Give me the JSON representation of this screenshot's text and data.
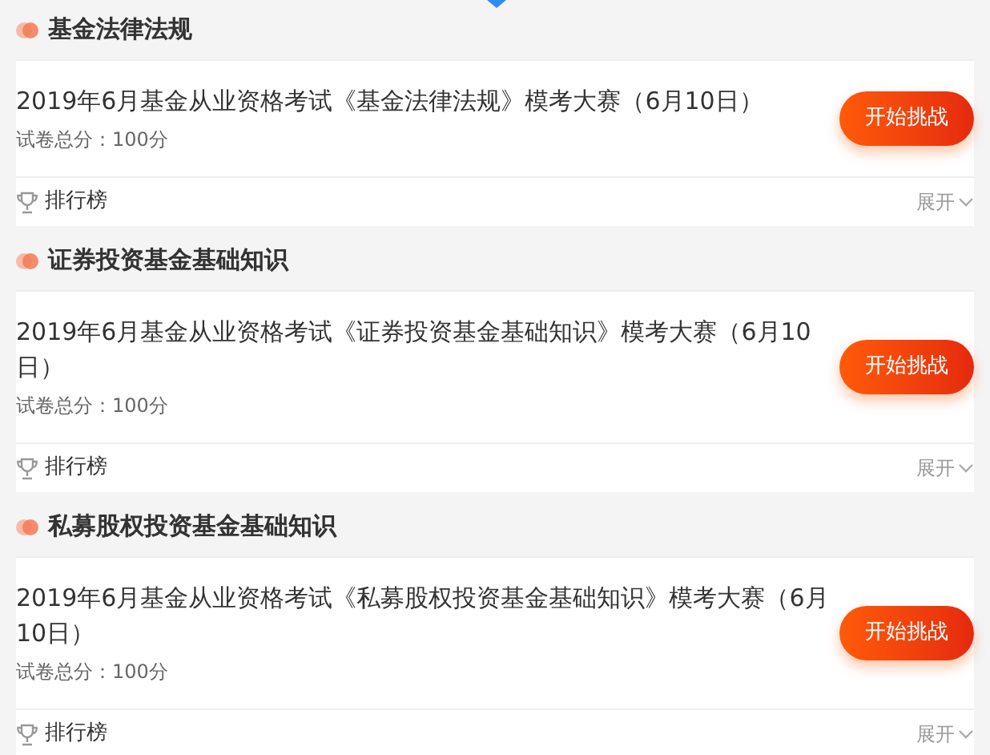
{
  "sections": [
    {
      "heading": "基金法律法规",
      "exam": {
        "title": "2019年6月基金从业资格考试《基金法律法规》模考大赛（6月10日）",
        "score": "试卷总分：100分",
        "button": "开始挑战",
        "ranking": "排行榜",
        "expand": "展开"
      }
    },
    {
      "heading": "证券投资基金基础知识",
      "exam": {
        "title": "2019年6月基金从业资格考试《证券投资基金基础知识》模考大赛（6月10日）",
        "score": "试卷总分：100分",
        "button": "开始挑战",
        "ranking": "排行榜",
        "expand": "展开"
      }
    },
    {
      "heading": "私募股权投资基金基础知识",
      "exam": {
        "title": "2019年6月基金从业资格考试《私募股权投资基金基础知识》模考大赛（6月10日）",
        "score": "试卷总分：100分",
        "button": "开始挑战",
        "ranking": "排行榜",
        "expand": "展开"
      }
    }
  ]
}
